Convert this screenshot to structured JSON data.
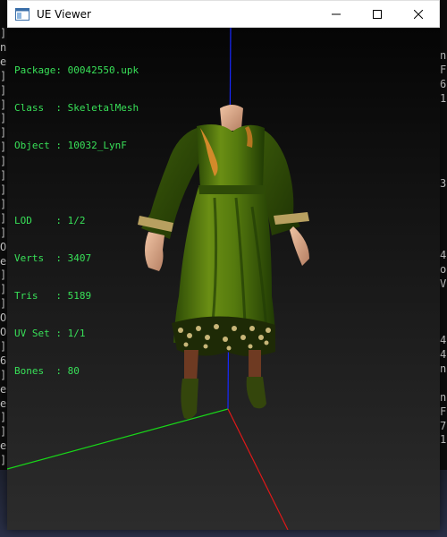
{
  "window": {
    "title": "UE Viewer"
  },
  "info": {
    "package_label": "Package: ",
    "package": "00042550.upk",
    "class_label": "Class  : ",
    "class": "SkeletalMesh",
    "object_label": "Object : ",
    "object": "10032_LynF",
    "lod_label": "LOD    : ",
    "lod": "1/2",
    "verts_label": "Verts  : ",
    "verts": "3407",
    "tris_label": "Tris   : ",
    "tris": "5189",
    "uvset_label": "UV Set : ",
    "uvset": "1/1",
    "bones_label": "Bones  : ",
    "bones": "80"
  },
  "background_console": {
    "left_chars": [
      "]",
      "n",
      "e",
      "]",
      "]",
      "]",
      "]",
      "]",
      "]",
      "]",
      "]",
      "]",
      "]",
      "]",
      "]",
      "O",
      "e",
      "]",
      "]",
      "]",
      "O",
      "O",
      "]",
      "6",
      "]",
      "e",
      "e",
      "]",
      "]",
      "e",
      "]"
    ],
    "right_chars": [
      "n",
      "F",
      "6",
      "1",
      "",
      "",
      "",
      "",
      "",
      "3",
      "",
      "",
      "",
      "",
      "4",
      "o",
      "V",
      "",
      "",
      "",
      "4",
      "4",
      "n",
      "",
      "n",
      "F",
      "7",
      "1"
    ]
  },
  "colors": {
    "hud_text": "#38e058",
    "axis_x": "#e01818",
    "axis_y": "#18d818",
    "axis_z": "#1828ff"
  }
}
